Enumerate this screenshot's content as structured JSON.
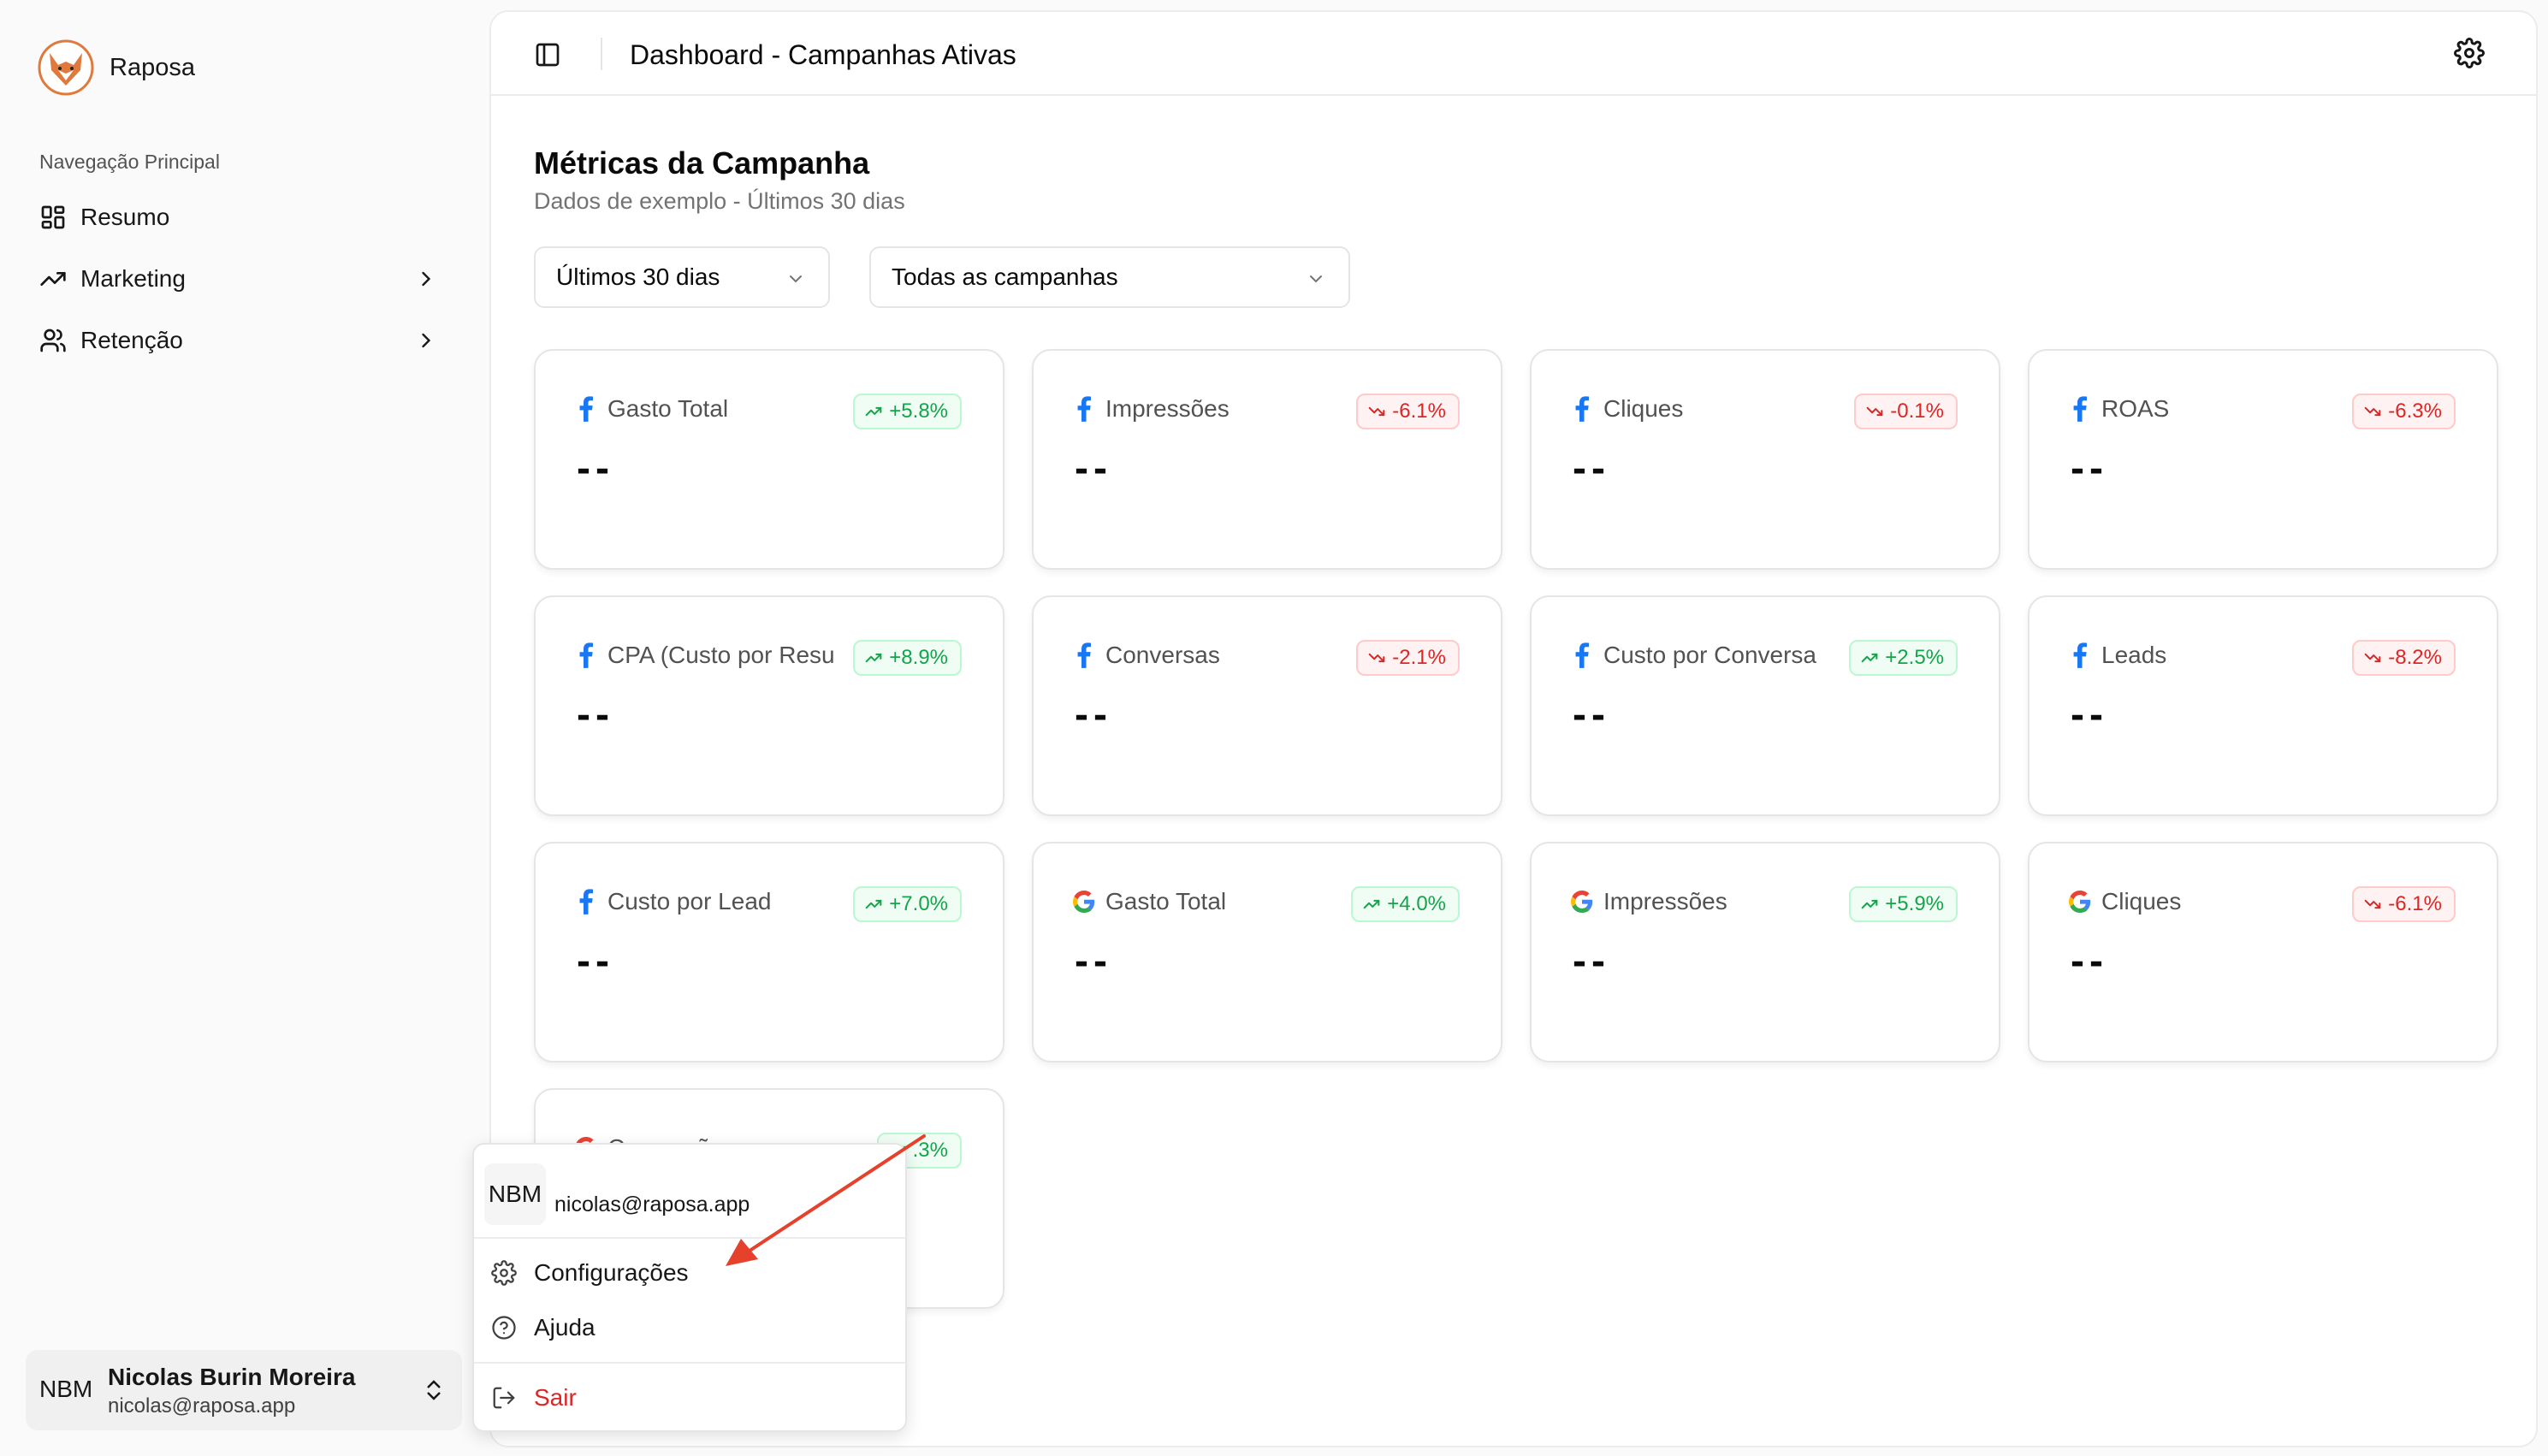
{
  "sidebar": {
    "brand_name": "Raposa",
    "group_label": "Navegação Principal",
    "items": [
      {
        "label": "Resumo",
        "icon": "layout-grid-icon"
      },
      {
        "label": "Marketing",
        "icon": "trending-up-icon"
      },
      {
        "label": "Retenção",
        "icon": "users-icon"
      }
    ],
    "user": {
      "initials": "NBM",
      "name": "Nicolas Burin Moreira",
      "email": "nicolas@raposa.app"
    }
  },
  "header": {
    "title": "Dashboard - Campanhas Ativas"
  },
  "main": {
    "title": "Métricas da Campanha",
    "subtitle": "Dados de exemplo - Últimos 30 dias",
    "filters": {
      "period": "Últimos 30 dias",
      "campaign": "Todas as campanhas"
    },
    "cards": [
      {
        "platform": "facebook",
        "label": "Gasto Total",
        "value": "--",
        "change": "+5.8%",
        "trend": "up"
      },
      {
        "platform": "facebook",
        "label": "Impressões",
        "value": "--",
        "change": "-6.1%",
        "trend": "down"
      },
      {
        "platform": "facebook",
        "label": "Cliques",
        "value": "--",
        "change": "-0.1%",
        "trend": "down"
      },
      {
        "platform": "facebook",
        "label": "ROAS",
        "value": "--",
        "change": "-6.3%",
        "trend": "down"
      },
      {
        "platform": "facebook",
        "label": "CPA (Custo por Resu",
        "value": "--",
        "change": "+8.9%",
        "trend": "up"
      },
      {
        "platform": "facebook",
        "label": "Conversas",
        "value": "--",
        "change": "-2.1%",
        "trend": "down"
      },
      {
        "platform": "facebook",
        "label": "Custo por Conversa",
        "value": "--",
        "change": "+2.5%",
        "trend": "up"
      },
      {
        "platform": "facebook",
        "label": "Leads",
        "value": "--",
        "change": "-8.2%",
        "trend": "down"
      },
      {
        "platform": "facebook",
        "label": "Custo por Lead",
        "value": "--",
        "change": "+7.0%",
        "trend": "up"
      },
      {
        "platform": "google",
        "label": "Gasto Total",
        "value": "--",
        "change": "+4.0%",
        "trend": "up"
      },
      {
        "platform": "google",
        "label": "Impressões",
        "value": "--",
        "change": "+5.9%",
        "trend": "up"
      },
      {
        "platform": "google",
        "label": "Cliques",
        "value": "--",
        "change": "-6.1%",
        "trend": "down"
      },
      {
        "platform": "google",
        "label": "Conversõ",
        "value": "--",
        "change": ".3%",
        "trend": "up"
      }
    ]
  },
  "user_menu": {
    "initials": "NBM",
    "email": "nicolas@raposa.app",
    "items": [
      {
        "label": "Configurações",
        "icon": "gear-icon"
      },
      {
        "label": "Ajuda",
        "icon": "help-circle-icon"
      },
      {
        "label": "Sair",
        "icon": "log-out-icon"
      }
    ]
  },
  "colors": {
    "up": "#16a34a",
    "down": "#dc2626",
    "facebook": "#1877f2",
    "annotation_arrow": "#e5412b",
    "brand": "#e07a3c"
  }
}
